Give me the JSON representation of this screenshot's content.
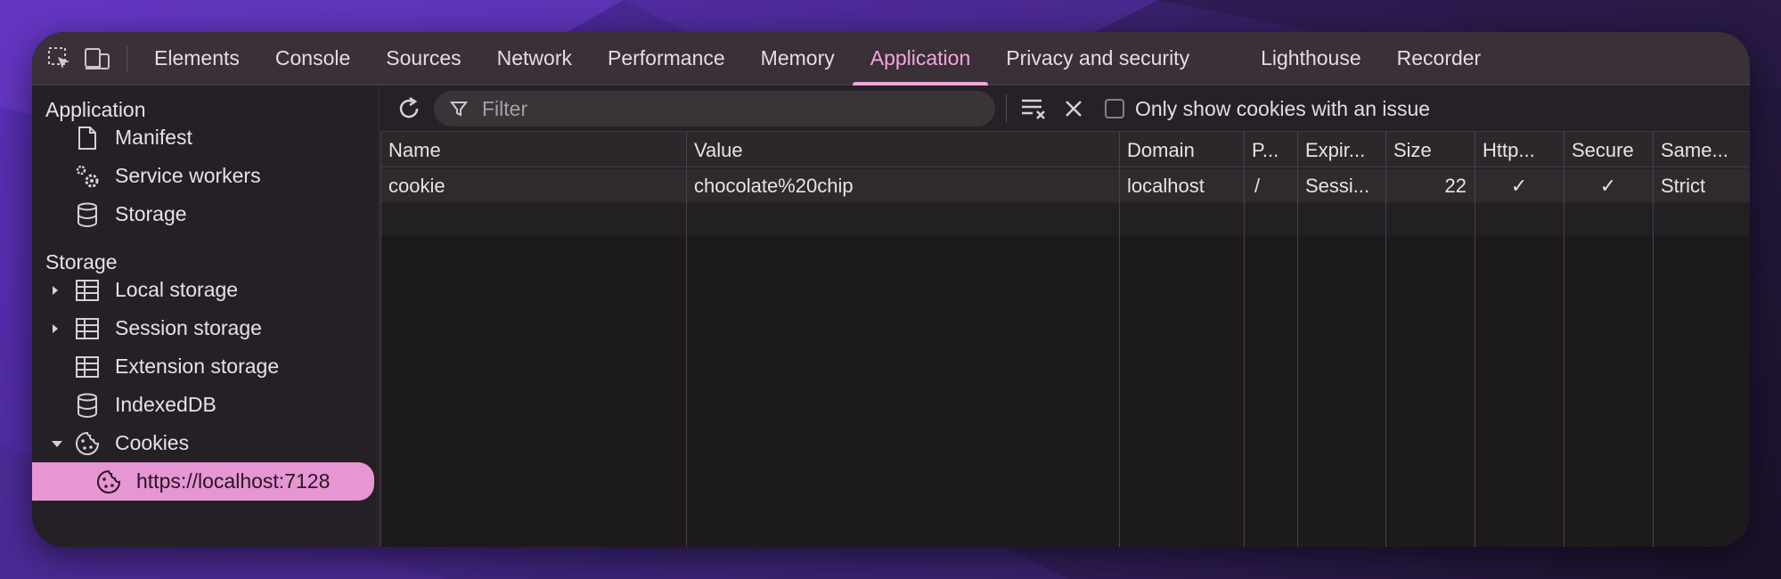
{
  "tabs": [
    {
      "label": "Elements"
    },
    {
      "label": "Console"
    },
    {
      "label": "Sources"
    },
    {
      "label": "Network"
    },
    {
      "label": "Performance"
    },
    {
      "label": "Memory"
    },
    {
      "label": "Application"
    },
    {
      "label": "Privacy and security"
    },
    {
      "label": "Lighthouse"
    },
    {
      "label": "Recorder"
    }
  ],
  "active_tab": "Application",
  "sidebar": {
    "application_heading": "Application",
    "application_items": [
      {
        "label": "Manifest",
        "icon": "document-icon"
      },
      {
        "label": "Service workers",
        "icon": "gears-icon"
      },
      {
        "label": "Storage",
        "icon": "database-icon"
      }
    ],
    "storage_heading": "Storage",
    "storage_items": [
      {
        "label": "Local storage",
        "icon": "table-icon"
      },
      {
        "label": "Session storage",
        "icon": "table-icon"
      },
      {
        "label": "Extension storage",
        "icon": "table-icon"
      },
      {
        "label": "IndexedDB",
        "icon": "database-icon"
      },
      {
        "label": "Cookies",
        "icon": "cookie-icon"
      },
      {
        "label": "https://localhost:7128",
        "icon": "cookie-icon"
      }
    ]
  },
  "toolbar": {
    "filter_placeholder": "Filter",
    "only_issue_label": "Only show cookies with an issue"
  },
  "table": {
    "columns": [
      "Name",
      "Value",
      "Domain",
      "P...",
      "Expir...",
      "Size",
      "Http...",
      "Secure",
      "Same..."
    ],
    "rows": [
      [
        "cookie",
        "chocolate%20chip",
        "localhost",
        "/",
        "Sessi...",
        "22",
        "✓",
        "✓",
        "Strict"
      ]
    ]
  },
  "colors": {
    "accent": "#f5a6de",
    "selected_bg": "#e596d3"
  }
}
